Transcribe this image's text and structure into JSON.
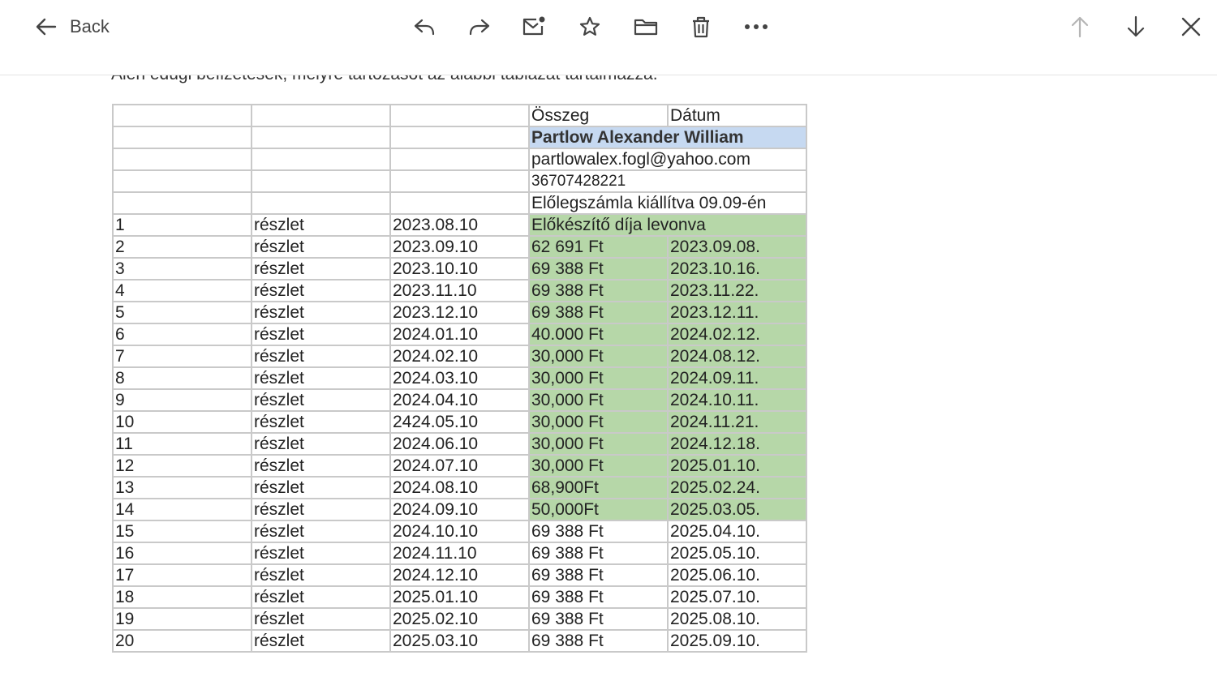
{
  "toolbar": {
    "back_label": "Back",
    "icons": [
      "back-arrow-icon",
      "reply-icon",
      "forward-icon",
      "mark-unread-icon",
      "star-icon",
      "folder-icon",
      "trash-icon",
      "more-icon",
      "previous-arrow-icon",
      "next-arrow-icon",
      "close-icon"
    ]
  },
  "email": {
    "clipped_intro": "Alen edugi befizetések, melyre tartozásot az alábbi táblázat tartalmazza."
  },
  "sheet": {
    "header": {
      "amount": "Összeg",
      "date": "Dátum"
    },
    "name": "Partlow Alexander William",
    "email": "partlowalex.fogl@yahoo.com",
    "phone": "36707428221",
    "invoice_note": "Előlegszámla kiállítva 09.09-én",
    "prep_note": "Előkészítő díja levonva",
    "rows": [
      {
        "n": "1",
        "type": "részlet",
        "due": "2023.08.10",
        "amount": "",
        "date": "",
        "paid": true
      },
      {
        "n": "2",
        "type": "részlet",
        "due": "2023.09.10",
        "amount": "62 691 Ft",
        "date": "2023.09.08.",
        "paid": true
      },
      {
        "n": "3",
        "type": "részlet",
        "due": "2023.10.10",
        "amount": "69 388 Ft",
        "date": "2023.10.16.",
        "paid": true
      },
      {
        "n": "4",
        "type": "részlet",
        "due": "2023.11.10",
        "amount": "69 388 Ft",
        "date": "2023.11.22.",
        "paid": true
      },
      {
        "n": "5",
        "type": "részlet",
        "due": "2023.12.10",
        "amount": "69 388 Ft",
        "date": "2023.12.11.",
        "paid": true
      },
      {
        "n": "6",
        "type": "részlet",
        "due": "2024.01.10",
        "amount": "40.000 Ft",
        "date": "2024.02.12.",
        "paid": true
      },
      {
        "n": "7",
        "type": "részlet",
        "due": "2024.02.10",
        "amount": "30,000 Ft",
        "date": "2024.08.12.",
        "paid": true
      },
      {
        "n": "8",
        "type": "részlet",
        "due": "2024.03.10",
        "amount": "30,000 Ft",
        "date": "2024.09.11.",
        "paid": true
      },
      {
        "n": "9",
        "type": "részlet",
        "due": "2024.04.10",
        "amount": "30,000 Ft",
        "date": "2024.10.11.",
        "paid": true
      },
      {
        "n": "10",
        "type": "részlet",
        "due": "2424.05.10",
        "amount": "30,000 Ft",
        "date": "2024.11.21.",
        "paid": true
      },
      {
        "n": "11",
        "type": "részlet",
        "due": "2024.06.10",
        "amount": "30,000 Ft",
        "date": "2024.12.18.",
        "paid": true
      },
      {
        "n": "12",
        "type": "részlet",
        "due": "2024.07.10",
        "amount": "30,000 Ft",
        "date": "2025.01.10.",
        "paid": true
      },
      {
        "n": "13",
        "type": "részlet",
        "due": "2024.08.10",
        "amount": "68,900Ft",
        "date": "2025.02.24.",
        "paid": true
      },
      {
        "n": "14",
        "type": "részlet",
        "due": "2024.09.10",
        "amount": "50,000Ft",
        "date": "2025.03.05.",
        "paid": true
      },
      {
        "n": "15",
        "type": "részlet",
        "due": "2024.10.10",
        "amount": "69 388 Ft",
        "date": "2025.04.10.",
        "paid": false
      },
      {
        "n": "16",
        "type": "részlet",
        "due": "2024.11.10",
        "amount": "69 388 Ft",
        "date": "2025.05.10.",
        "paid": false
      },
      {
        "n": "17",
        "type": "részlet",
        "due": "2024.12.10",
        "amount": "69 388 Ft",
        "date": "2025.06.10.",
        "paid": false
      },
      {
        "n": "18",
        "type": "részlet",
        "due": "2025.01.10",
        "amount": "69 388 Ft",
        "date": "2025.07.10.",
        "paid": false
      },
      {
        "n": "19",
        "type": "részlet",
        "due": "2025.02.10",
        "amount": "69 388 Ft",
        "date": "2025.08.10.",
        "paid": false
      },
      {
        "n": "20",
        "type": "részlet",
        "due": "2025.03.10",
        "amount": "69 388 Ft",
        "date": "2025.09.10.",
        "paid": false
      }
    ]
  },
  "colors": {
    "paid_green": "#b6d7a8",
    "name_blue": "#c6d9f1",
    "icon_gray": "#444444",
    "icon_disabled": "#b5b5b5"
  }
}
